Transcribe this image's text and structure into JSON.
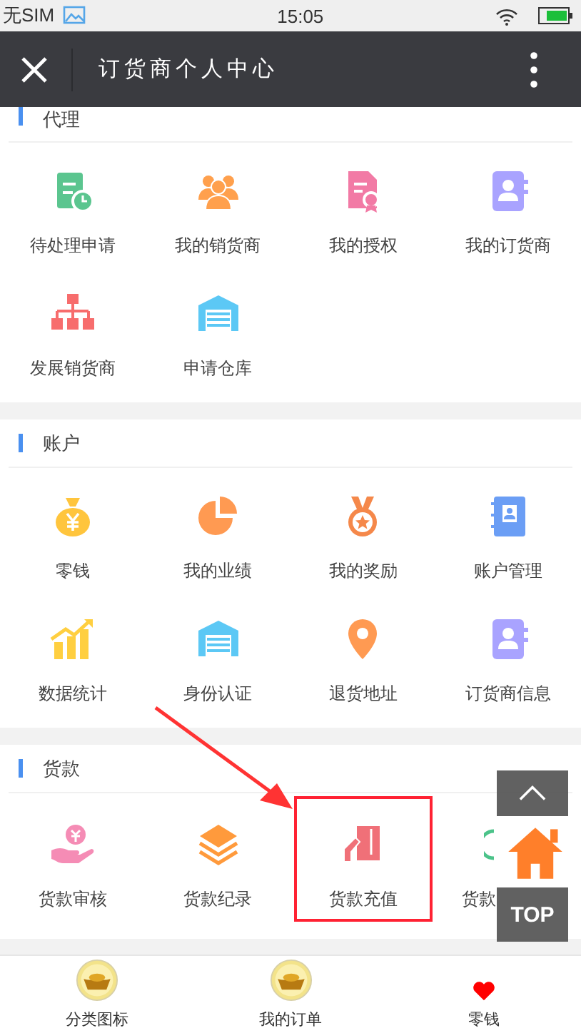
{
  "status_bar": {
    "carrier": "无SIM",
    "time": "15:05"
  },
  "title_bar": {
    "title": "订货商个人中心"
  },
  "sections": [
    {
      "title": "代理",
      "items": [
        {
          "label": "待处理申请",
          "highlighted": false
        },
        {
          "label": "我的销货商",
          "highlighted": false
        },
        {
          "label": "我的授权",
          "highlighted": false
        },
        {
          "label": "我的订货商",
          "highlighted": false
        },
        {
          "label": "发展销货商",
          "highlighted": false
        },
        {
          "label": "申请仓库",
          "highlighted": false
        }
      ]
    },
    {
      "title": "账户",
      "items": [
        {
          "label": "零钱",
          "highlighted": false
        },
        {
          "label": "我的业绩",
          "highlighted": false
        },
        {
          "label": "我的奖励",
          "highlighted": false
        },
        {
          "label": "账户管理",
          "highlighted": false
        },
        {
          "label": "数据统计",
          "highlighted": false
        },
        {
          "label": "身份认证",
          "highlighted": false
        },
        {
          "label": "退货地址",
          "highlighted": false
        },
        {
          "label": "订货商信息",
          "highlighted": false
        }
      ]
    },
    {
      "title": "货款",
      "items": [
        {
          "label": "货款审核",
          "highlighted": false
        },
        {
          "label": "货款纪录",
          "highlighted": false
        },
        {
          "label": "货款充值",
          "highlighted": true
        },
        {
          "label": "货款",
          "highlighted": false
        }
      ]
    }
  ],
  "floating": {
    "top_label": "TOP"
  },
  "bottom_nav": [
    {
      "label": "分类图标",
      "kind": "coin"
    },
    {
      "label": "我的订单",
      "kind": "coin"
    },
    {
      "label": "零钱",
      "kind": "heart"
    }
  ]
}
